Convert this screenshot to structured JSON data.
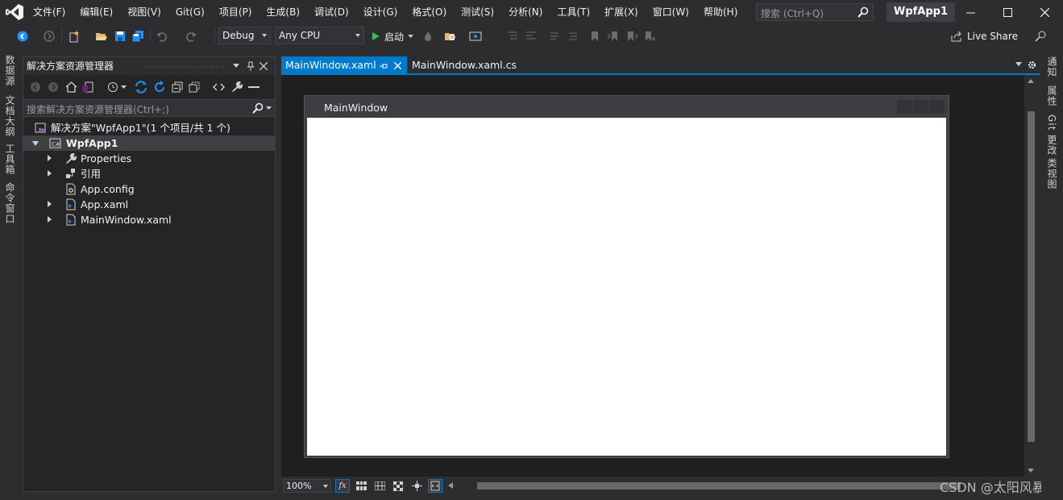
{
  "menu": {
    "items": [
      "文件(F)",
      "编辑(E)",
      "视图(V)",
      "Git(G)",
      "项目(P)",
      "生成(B)",
      "调试(D)",
      "设计(G)",
      "格式(O)",
      "测试(S)",
      "分析(N)",
      "工具(T)",
      "扩展(X)",
      "窗口(W)",
      "帮助(H)"
    ],
    "search_placeholder": "搜索 (Ctrl+Q)",
    "solution_name": "WpfApp1"
  },
  "toolbar": {
    "config": "Debug",
    "platform": "Any CPU",
    "start_label": "启动",
    "live_share_label": "Live Share"
  },
  "left_tabs": [
    "数据源",
    "文档大纲",
    "工具箱",
    "命令窗口"
  ],
  "right_tabs": [
    "通知",
    "属性",
    "Git 更改",
    "类视图"
  ],
  "solution_explorer": {
    "title": "解决方案资源管理器",
    "search_placeholder": "搜索解决方案资源管理器(Ctrl+;)",
    "solution_label": "解决方案\"WpfApp1\"(1 个项目/共 1 个)",
    "project_label": "WpfApp1",
    "items": [
      {
        "label": "Properties",
        "icon": "wrench-icon",
        "expandable": true
      },
      {
        "label": "引用",
        "icon": "references-icon",
        "expandable": true
      },
      {
        "label": "App.config",
        "icon": "config-file-icon",
        "expandable": false
      },
      {
        "label": "App.xaml",
        "icon": "xaml-file-icon",
        "expandable": true
      },
      {
        "label": "MainWindow.xaml",
        "icon": "xaml-file-icon",
        "expandable": true
      }
    ]
  },
  "tabs": {
    "active": "MainWindow.xaml",
    "inactive": "MainWindow.xaml.cs"
  },
  "designer": {
    "window_title": "MainWindow",
    "zoom": "100%",
    "fx_label": "fx"
  },
  "watermark": "CSDN @太阳风暴",
  "colors": {
    "accent": "#007acc",
    "background": "#2d2d30",
    "panel": "#252526"
  }
}
